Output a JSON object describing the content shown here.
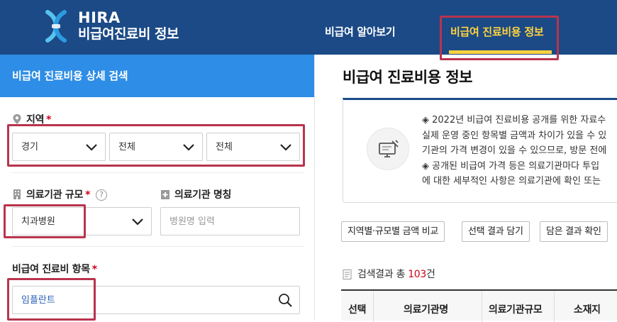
{
  "header": {
    "logo_name": "HIRA",
    "logo_subtitle": "비급여진료비 정보",
    "nav": [
      {
        "label": "비급여 알아보기"
      },
      {
        "label": "비급여 진료비용 정보"
      }
    ]
  },
  "left": {
    "title": "비급여 진료비용 상세 검색",
    "region": {
      "label": "지역",
      "required_mark": "*",
      "selects": [
        {
          "value": "경기"
        },
        {
          "value": "전체"
        },
        {
          "value": "전체"
        }
      ]
    },
    "scale": {
      "label": "의료기관 규모",
      "required_mark": "*",
      "help_glyph": "?",
      "value": "치과병원"
    },
    "name": {
      "label": "의료기관 명칭",
      "placeholder": "병원명 입력"
    },
    "item": {
      "label": "비급여 진료비 항목",
      "required_mark": "*",
      "value": "임플란트"
    }
  },
  "right": {
    "title": "비급여 진료비용 정보",
    "notice_lines": [
      "◈ 2022년 비급여 진료비용 공개를 위한 자료수",
      "실제 운영 중인 항목별 금액과 차이가 있을 수 있",
      "기관의 가격 변경이 있을 수 있으므로, 방문 전에",
      "◈ 공개된 비급여 가격 등은 의료기관마다 투입",
      "에 대한 세부적인 사항은 의료기관에 확인 또는"
    ],
    "buttons": [
      {
        "label": "지역별·규모별 금액 비교"
      },
      {
        "label": "선택 결과 담기"
      },
      {
        "label": "담은 결과 확인"
      }
    ],
    "result": {
      "prefix": "검색결과 총 ",
      "count": "103",
      "suffix": "건"
    },
    "table_headers": [
      "선택",
      "의료기관명",
      "의료기관규모",
      "소재지"
    ]
  },
  "colors": {
    "header_bg": "#1b4a86",
    "accent_yellow": "#ffd23f",
    "panel_blue": "#2e8de6",
    "highlight_red": "#b8344d",
    "required_red": "#d0021b",
    "value_blue": "#2a5fb5"
  },
  "icons": {
    "logo": "hira-logo-icon",
    "region": "location-pin-icon",
    "scale": "building-icon",
    "name": "hospital-cross-icon",
    "search": "search-icon",
    "select": "chevron-down-icon",
    "notice": "monitor-tools-icon",
    "result": "document-icon"
  }
}
